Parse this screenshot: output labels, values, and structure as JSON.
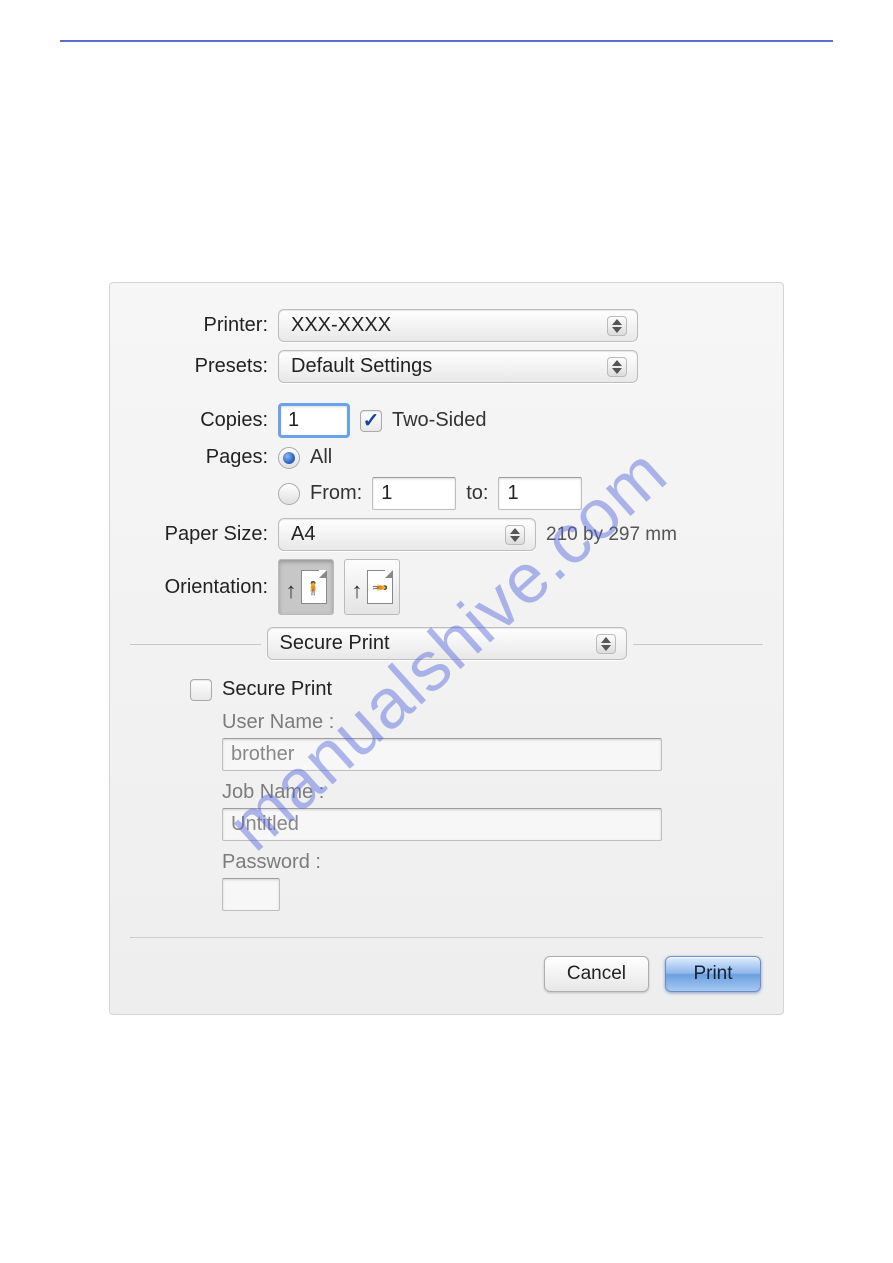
{
  "watermark": "manualshive.com",
  "labels": {
    "printer": "Printer:",
    "presets": "Presets:",
    "copies": "Copies:",
    "two_sided": "Two-Sided",
    "pages": "Pages:",
    "pages_all": "All",
    "pages_from": "From:",
    "pages_to": "to:",
    "paper_size": "Paper Size:",
    "orientation": "Orientation:"
  },
  "printer": {
    "value": "XXX-XXXX"
  },
  "presets": {
    "value": "Default Settings"
  },
  "copies": {
    "value": "1",
    "two_sided_checked": true
  },
  "pages": {
    "mode": "all",
    "from": "1",
    "to": "1"
  },
  "paper_size": {
    "value": "A4",
    "dimensions": "210 by 297 mm"
  },
  "pane_selector": {
    "value": "Secure Print"
  },
  "secure": {
    "checkbox_label": "Secure Print",
    "checked": false,
    "user_name_label": "User Name :",
    "user_name": "brother",
    "job_name_label": "Job Name :",
    "job_name": "Untitled",
    "password_label": "Password :",
    "password": ""
  },
  "buttons": {
    "cancel": "Cancel",
    "print": "Print"
  }
}
